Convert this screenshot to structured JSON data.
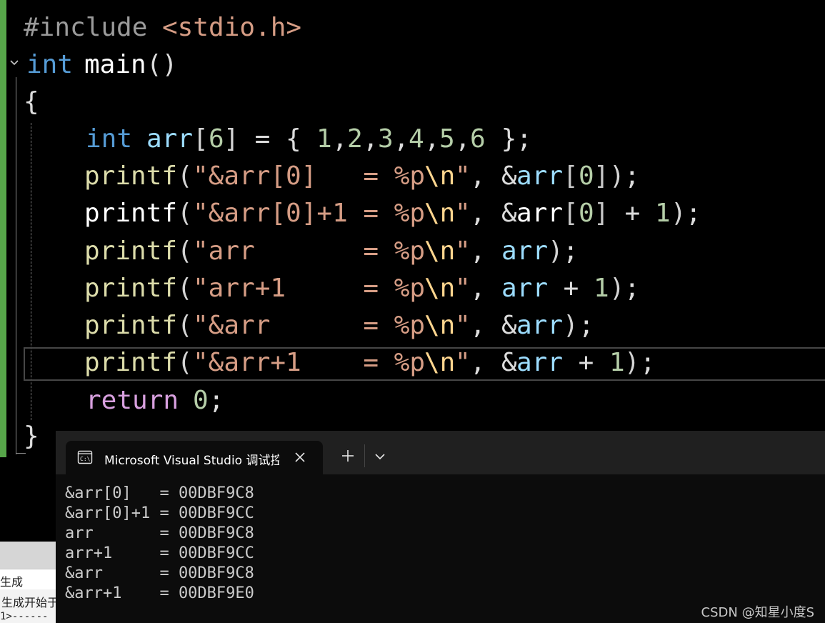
{
  "editor": {
    "lines": {
      "include": {
        "hash": "#include",
        "header": "<stdio.h>"
      },
      "main_sig": {
        "kw": "int",
        "name": "main",
        "parens": "()"
      },
      "open_brace": "{",
      "arr_decl": {
        "kw": "int",
        "name": "arr",
        "b1": "[",
        "size": "6",
        "b2": "]",
        "eq": " = ",
        "lb": "{",
        "n1": "1",
        "c1": ",",
        "n2": "2",
        "c2": ",",
        "n3": "3",
        "c3": ",",
        "n4": "4",
        "c4": ",",
        "n5": "5",
        "c5": ",",
        "n6": "6",
        "rb": " }",
        "semi": ";"
      },
      "p1": {
        "fn": "printf",
        "lp": "(",
        "str": "\"&arr[0]   = %p",
        "esc": "\\n",
        "q": "\"",
        "comma": ", ",
        "amp": "&",
        "var": "arr",
        "lb": "[",
        "idx": "0",
        "rb": "]",
        "rp": ")",
        "semi": ";"
      },
      "p2": {
        "fn": "printf",
        "lp": "(",
        "str": "\"&arr[0]+1 = %p",
        "esc": "\\n",
        "q": "\"",
        "comma": ", ",
        "amp": "&",
        "var": "arr",
        "lb": "[",
        "idx": "0",
        "rb": "]",
        "plus": " + ",
        "one": "1",
        "rp": ")",
        "semi": ";"
      },
      "p3": {
        "fn": "printf",
        "lp": "(",
        "str": "\"arr       = %p",
        "esc": "\\n",
        "q": "\"",
        "comma": ", ",
        "var": "arr",
        "rp": ")",
        "semi": ";"
      },
      "p4": {
        "fn": "printf",
        "lp": "(",
        "str": "\"arr+1     = %p",
        "esc": "\\n",
        "q": "\"",
        "comma": ", ",
        "var": "arr",
        "plus": " + ",
        "one": "1",
        "rp": ")",
        "semi": ";"
      },
      "p5": {
        "fn": "printf",
        "lp": "(",
        "str": "\"&arr      = %p",
        "esc": "\\n",
        "q": "\"",
        "comma": ", ",
        "amp": "&",
        "var": "arr",
        "rp": ")",
        "semi": ";"
      },
      "p6": {
        "fn": "printf",
        "lp": "(",
        "str": "\"&arr+1    = %p",
        "esc": "\\n",
        "q": "\"",
        "comma": ", ",
        "amp": "&",
        "var": "arr",
        "plus": " + ",
        "one": "1",
        "rp": ")",
        "semi": ";"
      },
      "ret": {
        "kw": "return",
        "num": "0",
        "semi": ";"
      },
      "close_brace": "}"
    },
    "colors": {
      "change_bar": "#57a64a",
      "background": "#000000"
    }
  },
  "output_pane": {
    "tab_label": "生成",
    "line1": "生成开始于",
    "line2": "1>------"
  },
  "terminal": {
    "tab_title": "Microsoft Visual Studio 调试控制台",
    "icon": "terminal-icon",
    "output": [
      "&arr[0]   = 00DBF9C8",
      "&arr[0]+1 = 00DBF9CC",
      "arr       = 00DBF9C8",
      "arr+1     = 00DBF9CC",
      "&arr      = 00DBF9C8",
      "&arr+1    = 00DBF9E0"
    ]
  },
  "watermark": "CSDN @知星小度S"
}
